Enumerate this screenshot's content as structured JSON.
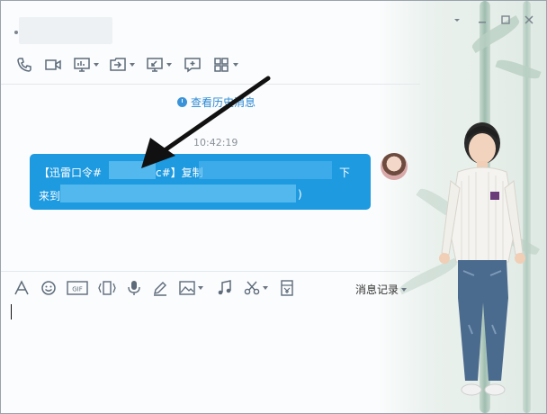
{
  "window": {
    "title": "",
    "buttons": [
      "minimize",
      "maximize",
      "close"
    ]
  },
  "toolbar": {
    "items": [
      {
        "icon": "phone-icon"
      },
      {
        "icon": "video-icon"
      },
      {
        "icon": "screen-share-icon",
        "has_dropdown": true
      },
      {
        "icon": "remote-desktop-icon",
        "has_dropdown": true
      },
      {
        "icon": "screenshot-icon",
        "has_dropdown": true
      },
      {
        "icon": "add-chat-icon"
      },
      {
        "icon": "apps-grid-icon",
        "has_dropdown": true
      }
    ]
  },
  "chat": {
    "history_link": "查看历史消息",
    "timestamp": "10:42:19",
    "message": {
      "line1_a": "【迅雷口令#",
      "line1_b": "c#】复制",
      "line1_c": "下",
      "line2_a": "来到",
      "line2_b": ")"
    }
  },
  "input_toolbar": {
    "items": [
      {
        "icon": "font-icon"
      },
      {
        "icon": "emoji-icon"
      },
      {
        "icon": "gif-icon"
      },
      {
        "icon": "shake-icon"
      },
      {
        "icon": "voice-icon"
      },
      {
        "icon": "handwrite-icon"
      },
      {
        "icon": "image-icon",
        "has_dropdown": true
      },
      {
        "icon": "music-icon"
      },
      {
        "icon": "scissors-icon",
        "has_dropdown": true
      },
      {
        "icon": "red-packet-icon"
      }
    ],
    "records_label": "消息记录"
  },
  "colors": {
    "bubble": "#1e9ae0",
    "link": "#2d8ad4",
    "arrow": "#111111"
  }
}
